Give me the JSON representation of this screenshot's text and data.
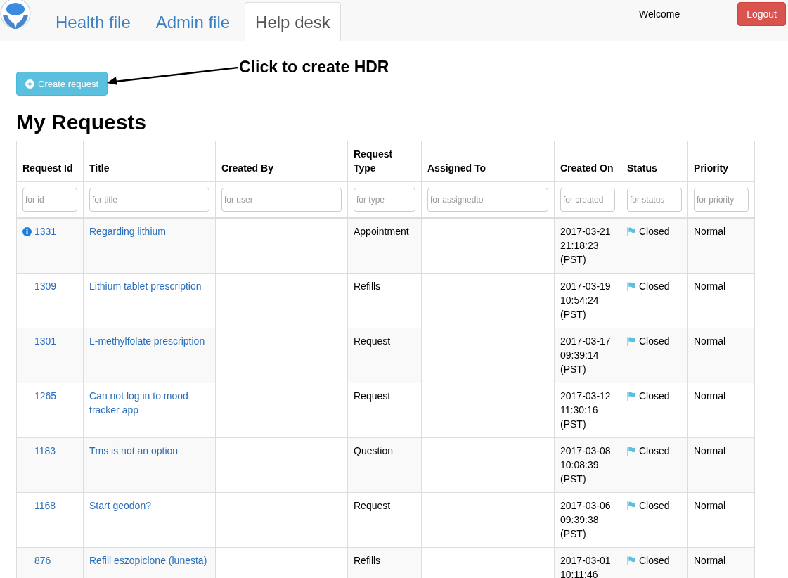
{
  "navbar": {
    "tabs": [
      {
        "label": "Health file",
        "selected": false
      },
      {
        "label": "Admin file",
        "selected": false
      },
      {
        "label": "Help desk",
        "selected": true
      }
    ],
    "welcome": "Welcome",
    "logout": "Logout"
  },
  "create_button": "Create request",
  "annotation": "Click to create HDR",
  "heading": "My Requests",
  "table": {
    "columns": [
      {
        "label": "Request Id",
        "placeholder": "for id"
      },
      {
        "label": "Title",
        "placeholder": "for title"
      },
      {
        "label": "Created By",
        "placeholder": "for user"
      },
      {
        "label": "Request Type",
        "placeholder": "for type"
      },
      {
        "label": "Assigned To",
        "placeholder": "for assignedto"
      },
      {
        "label": "Created On",
        "placeholder": "for created"
      },
      {
        "label": "Status",
        "placeholder": "for status"
      },
      {
        "label": "Priority",
        "placeholder": "for priority"
      }
    ],
    "rows": [
      {
        "id": "1331",
        "info": true,
        "title": "Regarding lithium",
        "type": "Appointment",
        "created": [
          "2017-03-21",
          "21:18:23",
          "(PST)"
        ],
        "status": "Closed",
        "priority": "Normal"
      },
      {
        "id": "1309",
        "info": false,
        "title": "Lithium tablet prescription",
        "type": "Refills",
        "created": [
          "2017-03-19",
          "10:54:24",
          "(PST)"
        ],
        "status": "Closed",
        "priority": "Normal"
      },
      {
        "id": "1301",
        "info": false,
        "title": "L-methylfolate prescription",
        "type": "Request",
        "created": [
          "2017-03-17",
          "09:39:14",
          "(PST)"
        ],
        "status": "Closed",
        "priority": "Normal"
      },
      {
        "id": "1265",
        "info": false,
        "title": "Can not log in to mood tracker app",
        "type": "Request",
        "created": [
          "2017-03-12",
          "11:30:16",
          "(PST)"
        ],
        "status": "Closed",
        "priority": "Normal"
      },
      {
        "id": "1183",
        "info": false,
        "title": "Tms is not an option",
        "type": "Question",
        "created": [
          "2017-03-08",
          "10:08:39",
          "(PST)"
        ],
        "status": "Closed",
        "priority": "Normal"
      },
      {
        "id": "1168",
        "info": false,
        "title": "Start geodon?",
        "type": "Request",
        "created": [
          "2017-03-06",
          "09:39:38",
          "(PST)"
        ],
        "status": "Closed",
        "priority": "Normal"
      },
      {
        "id": "876",
        "info": false,
        "title": "Refill eszopiclone (lunesta)",
        "type": "Refills",
        "created": [
          "2017-03-01",
          "10:11:46"
        ],
        "status": "Closed",
        "priority": "Normal"
      }
    ]
  }
}
